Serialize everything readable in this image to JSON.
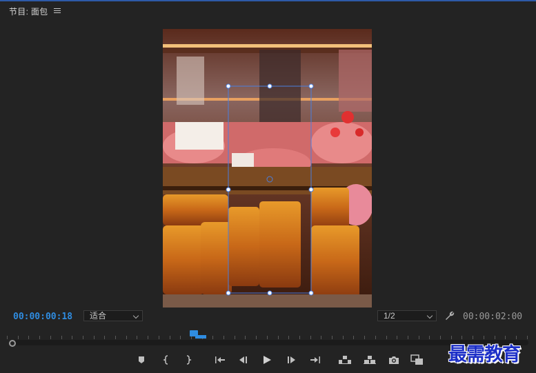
{
  "panel": {
    "title": "节目: 面包",
    "menu_icon": "hamburger-menu-icon"
  },
  "monitor": {
    "current_timecode": "00:00:00:18",
    "duration_timecode": "00:00:02:00",
    "zoom": {
      "selected": "适合"
    },
    "resolution": {
      "selected": "1/2"
    },
    "playhead_position_fraction": 0.37
  },
  "controls": {
    "add_marker": "marker-icon",
    "mark_in": "mark-in-icon",
    "mark_out": "mark-out-icon",
    "go_to_in": "go-to-in-icon",
    "step_back": "step-back-icon",
    "play": "play-icon",
    "step_forward": "step-forward-icon",
    "go_to_out": "go-to-out-icon",
    "lift": "lift-icon",
    "extract": "extract-icon",
    "export_frame": "camera-icon",
    "comparison_view": "comparison-view-icon",
    "button_editor": "+"
  },
  "watermark": {
    "text": "最需教育"
  },
  "colors": {
    "accent": "#2f8ce0",
    "background": "#232323",
    "watermark": "#1c2fc7"
  }
}
